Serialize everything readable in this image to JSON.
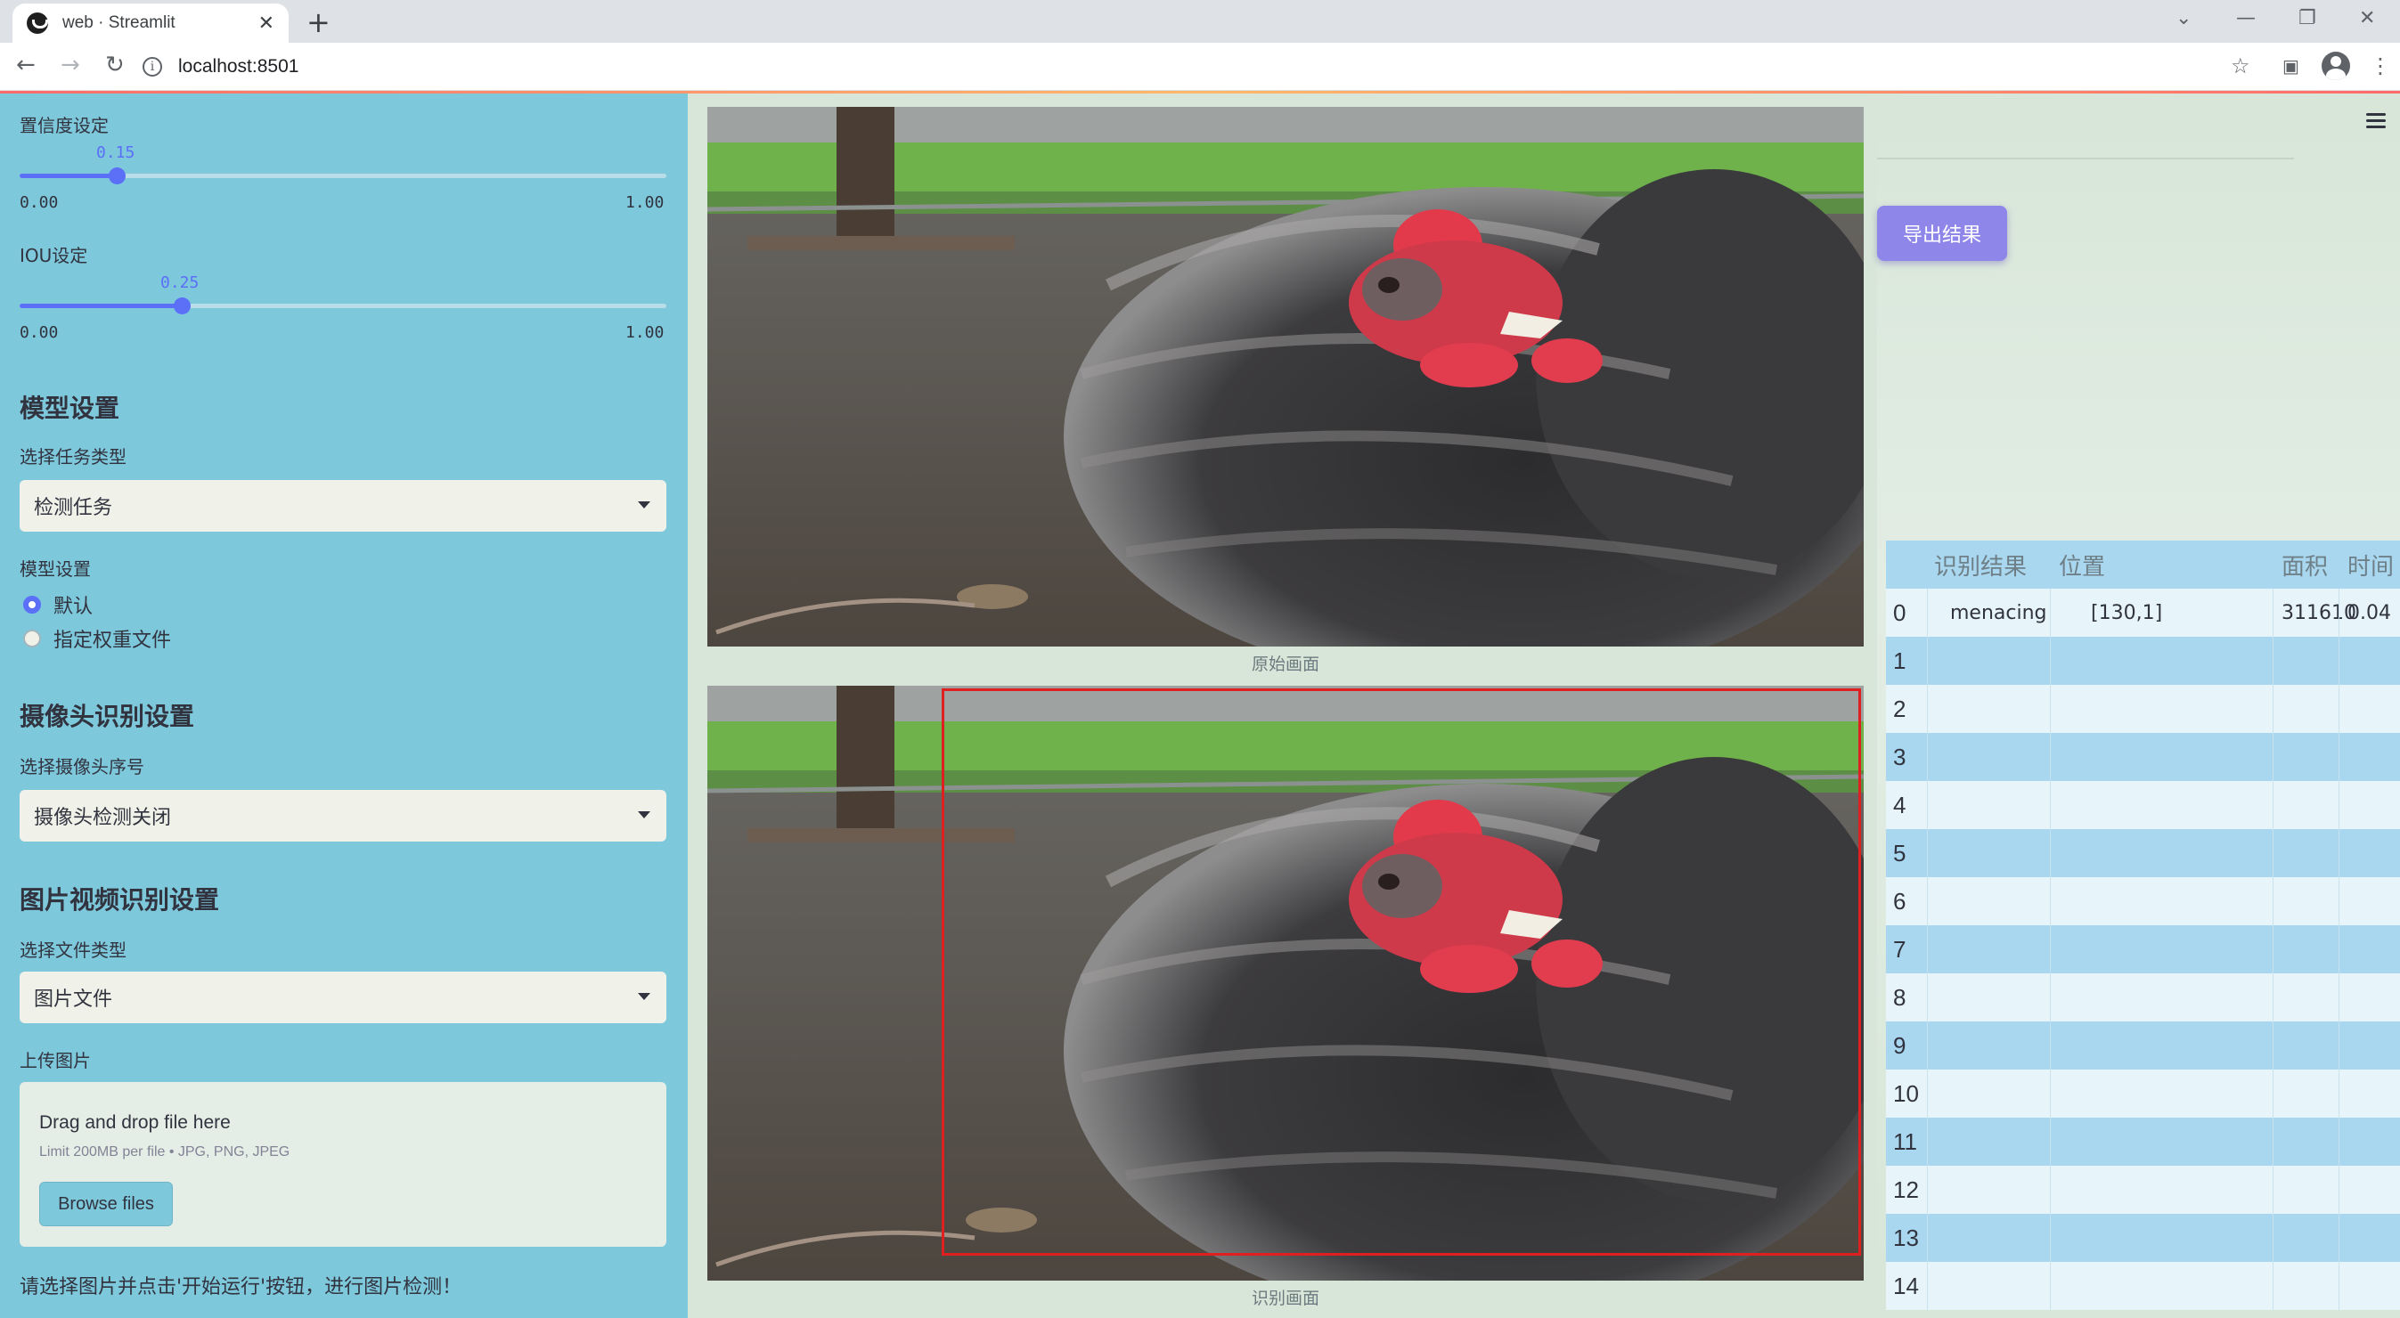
{
  "browser": {
    "tab_title": "web · Streamlit",
    "tab_close": "✕",
    "new_tab": "+",
    "url": "localhost:8501",
    "info_glyph": "i",
    "minimize": "—",
    "restore": "❐",
    "close": "✕",
    "expand": "⌄"
  },
  "sidebar": {
    "confidence": {
      "label": "置信度设定",
      "value": "0.15",
      "min": "0.00",
      "max": "1.00",
      "fraction": 0.15
    },
    "iou": {
      "label": "IOU设定",
      "value": "0.25",
      "min": "0.00",
      "max": "1.00",
      "fraction": 0.25
    },
    "model_section": {
      "heading": "模型设置",
      "task_label": "选择任务类型",
      "task_value": "检测任务",
      "model_label": "模型设置",
      "options": [
        {
          "label": "默认",
          "selected": true
        },
        {
          "label": "指定权重文件",
          "selected": false
        }
      ]
    },
    "camera_section": {
      "heading": "摄像头识别设置",
      "label": "选择摄像头序号",
      "value": "摄像头检测关闭"
    },
    "media_section": {
      "heading": "图片视频识别设置",
      "file_type_label": "选择文件类型",
      "file_type_value": "图片文件",
      "upload_label": "上传图片",
      "drop_title": "Drag and drop file here",
      "drop_limit": "Limit 200MB per file • JPG, PNG, JPEG",
      "browse_label": "Browse files"
    },
    "hint": "请选择图片并点击'开始运行'按钮，进行图片检测！"
  },
  "main": {
    "original_caption": "原始画面",
    "detected_caption": "识别画面",
    "export_label": "导出结果"
  },
  "table": {
    "headers": [
      "识别结果",
      "位置",
      "面积",
      "时间"
    ],
    "rows": [
      {
        "index": "0",
        "result": "menacing",
        "position": "[130,1]",
        "area": "311610",
        "time": "0.04"
      },
      {
        "index": "1"
      },
      {
        "index": "2"
      },
      {
        "index": "3"
      },
      {
        "index": "4"
      },
      {
        "index": "5"
      },
      {
        "index": "6"
      },
      {
        "index": "7"
      },
      {
        "index": "8"
      },
      {
        "index": "9"
      },
      {
        "index": "10"
      },
      {
        "index": "11"
      },
      {
        "index": "12"
      },
      {
        "index": "13"
      },
      {
        "index": "14"
      }
    ]
  },
  "colors": {
    "sidebar_bg": "#7ec8dc",
    "main_bg": "#d7e6d8",
    "accent": "#5b6ff7",
    "export_button": "#8f86ea",
    "detection_box": "#e02020",
    "table_row_a": "#a8d7ef",
    "table_row_b": "#e7f5fb"
  },
  "icons": [
    "back-icon",
    "forward-icon",
    "reload-icon",
    "info-icon",
    "star-icon",
    "side-panel-icon",
    "profile-icon",
    "menu-dots-icon",
    "hamburger-menu-icon",
    "chevron-down-icon"
  ]
}
